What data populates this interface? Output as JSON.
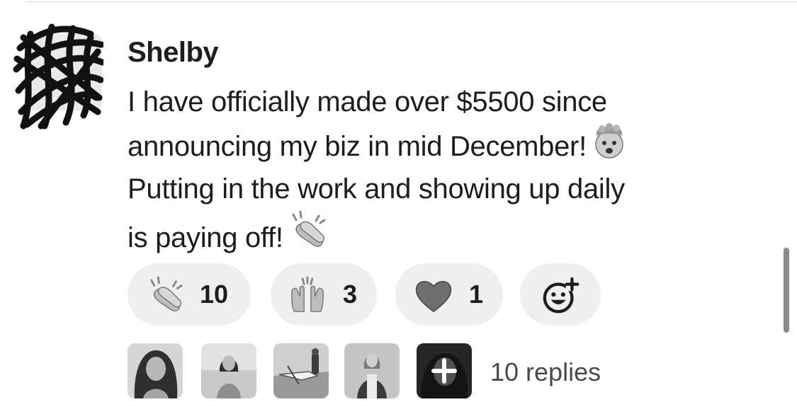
{
  "post": {
    "author": "Shelby",
    "message_lines": [
      "I have officially made over $5500 since",
      "announcing my biz in mid December!",
      "Putting in the work and showing up daily",
      "is paying off!"
    ],
    "inline_emojis": [
      "exploding-head",
      "clapping-hands"
    ]
  },
  "reactions": [
    {
      "emoji": "clapping-hands",
      "count": "10"
    },
    {
      "emoji": "raising-hands",
      "count": "3"
    },
    {
      "emoji": "heart",
      "count": "1"
    },
    {
      "emoji": "add-reaction",
      "count": ""
    }
  ],
  "thread": {
    "reply_avatars": [
      "user-photo-1",
      "user-photo-2",
      "user-photo-3",
      "user-photo-4",
      "more-replies-plus"
    ],
    "replies_label": "10 replies"
  }
}
